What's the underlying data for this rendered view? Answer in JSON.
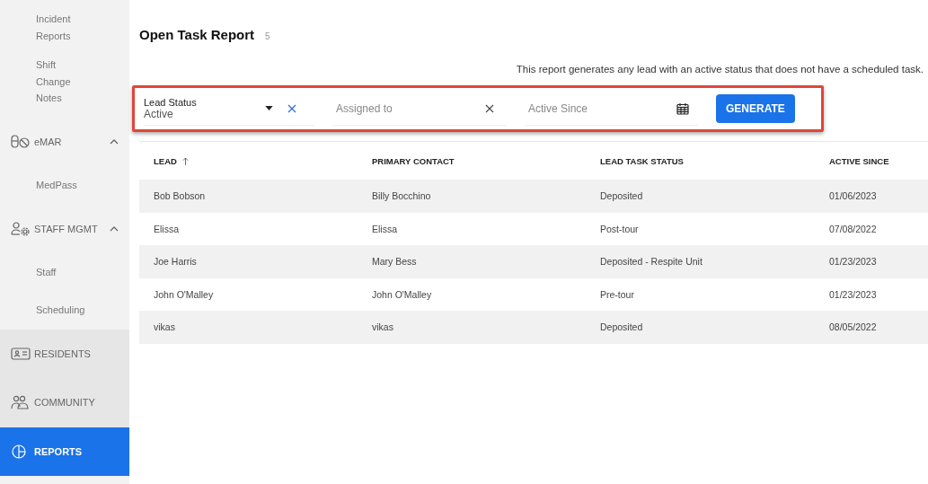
{
  "sidebar": {
    "items": [
      {
        "kind": "link",
        "label": "Incident Reports",
        "selected": false
      },
      {
        "kind": "link",
        "label": "Shift Change Notes",
        "selected": false
      },
      {
        "kind": "group",
        "label": "eMAR",
        "expanded": true,
        "selected": false,
        "children": [
          {
            "label": "MedPass",
            "selected": false
          }
        ]
      },
      {
        "kind": "group",
        "label": "STAFF MGMT",
        "expanded": true,
        "selected": false,
        "children": [
          {
            "label": "Staff",
            "selected": false
          },
          {
            "label": "Scheduling",
            "selected": false
          }
        ]
      },
      {
        "kind": "section",
        "label": "RESIDENTS",
        "selected": false
      },
      {
        "kind": "section",
        "label": "COMMUNITY",
        "selected": false
      },
      {
        "kind": "section",
        "label": "REPORTS",
        "selected": true
      }
    ]
  },
  "report": {
    "title": "Open Task Report",
    "count": "5",
    "description": "This report generates any lead with an active status that does not have a scheduled task."
  },
  "filters": {
    "lead_status": {
      "label": "Lead Status",
      "value": "Active"
    },
    "assigned_to": {
      "placeholder": "Assigned to"
    },
    "active_since": {
      "placeholder": "Active Since"
    },
    "button": "GENERATE"
  },
  "table": {
    "columns": [
      {
        "label": "LEAD",
        "sorted": true
      },
      {
        "label": "PRIMARY CONTACT",
        "sorted": false
      },
      {
        "label": "LEAD TASK STATUS",
        "sorted": false
      },
      {
        "label": "ACTIVE SINCE",
        "sorted": false
      }
    ],
    "rows": [
      [
        "Bob Bobson",
        "Billy Bocchino",
        "Deposited",
        "01/06/2023"
      ],
      [
        "Elissa",
        "Elissa",
        "Post-tour",
        "07/08/2022"
      ],
      [
        "Joe Harris",
        "Mary Bess",
        "Deposited - Respite Unit",
        "01/23/2023"
      ],
      [
        "John O'Malley",
        "John O'Malley",
        "Pre-tour",
        "01/23/2023"
      ],
      [
        "vikas",
        "vikas",
        "Deposited",
        "08/05/2022"
      ]
    ]
  }
}
